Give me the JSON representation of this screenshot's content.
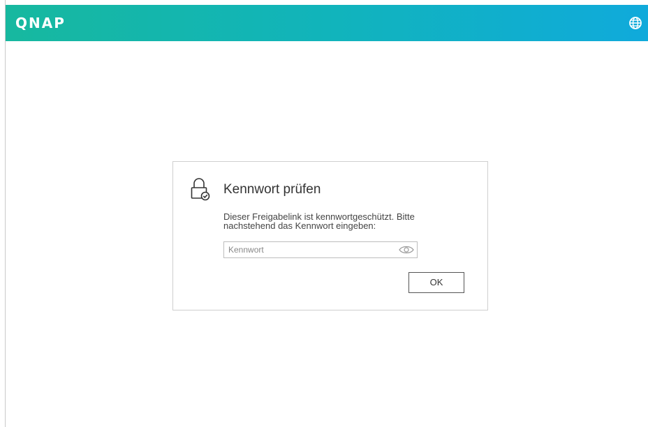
{
  "header": {
    "logo_text": "QNAP",
    "background_gradient": [
      "#17b89f",
      "#10aadb"
    ],
    "language_icon": "globe-icon"
  },
  "dialog": {
    "icon": "lock-check-icon",
    "title": "Kennwort prüfen",
    "message_line1": "Dieser Freigabelink ist kennwortgeschützt. Bitte",
    "message_line2": "nachstehend das Kennwort eingeben:",
    "password_field": {
      "placeholder": "Kennwort",
      "value": "",
      "toggle_icon": "eye-icon"
    },
    "ok_label": "OK"
  }
}
